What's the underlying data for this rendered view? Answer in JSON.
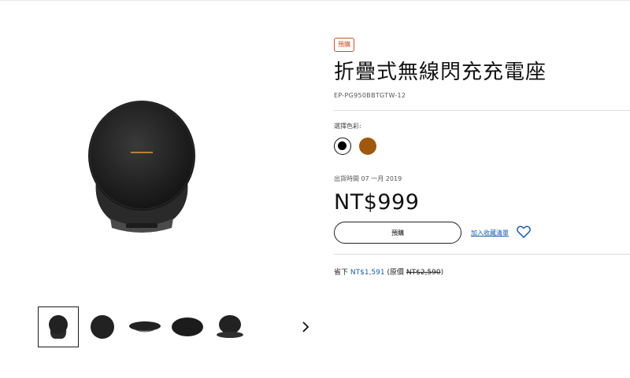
{
  "product": {
    "badge": "預購",
    "title": "折疊式無線閃充充電座",
    "sku": "EP-PG950BBTGTW-12",
    "color_label": "選擇色彩:",
    "colors": [
      {
        "name": "black",
        "hex": "#000000",
        "selected": true
      },
      {
        "name": "brown",
        "hex": "#a0570e",
        "selected": false
      }
    ],
    "release": "出貨時間 07 一月 2019",
    "price": "NT$999",
    "preorder_label": "預購",
    "wishlist_label": "加入收藏清單",
    "savings": {
      "prefix": "省下",
      "amount": "NT$1,591",
      "original_prefix": "(原價",
      "original_price": "NT$2,590",
      "suffix": ")"
    }
  },
  "gallery": {
    "thumbnail_count": 5,
    "selected_index": 0,
    "next_icon": "chevron-right-icon"
  },
  "colors": {
    "accent_orange": "#c9532a",
    "link_blue": "#1a5ea8"
  }
}
